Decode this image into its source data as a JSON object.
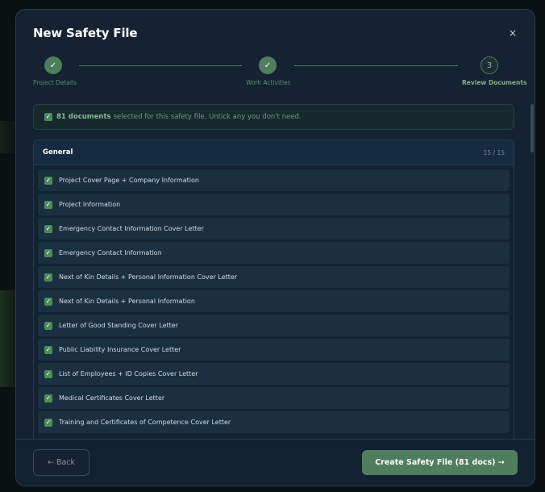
{
  "modal": {
    "title": "New Safety File",
    "close_label": "×"
  },
  "stepper": {
    "steps": [
      {
        "label": "Project Details",
        "state": "done",
        "marker": "✓"
      },
      {
        "label": "Work Activities",
        "state": "done",
        "marker": "✓"
      },
      {
        "label": "Review Documents",
        "state": "current",
        "marker": "3"
      }
    ]
  },
  "info": {
    "count_text": "81 documents",
    "message": "selected for this safety file. Untick any you don't need."
  },
  "group": {
    "title": "General",
    "count": "15 / 15",
    "items": [
      {
        "label": "Project Cover Page + Company Information",
        "checked": true
      },
      {
        "label": "Project Information",
        "checked": true
      },
      {
        "label": "Emergency Contact Information Cover Letter",
        "checked": true
      },
      {
        "label": "Emergency Contact Information",
        "checked": true
      },
      {
        "label": "Next of Kin Details + Personal Information Cover Letter",
        "checked": true
      },
      {
        "label": "Next of Kin Details + Personal Information",
        "checked": true
      },
      {
        "label": "Letter of Good Standing Cover Letter",
        "checked": true
      },
      {
        "label": "Public Liability Insurance Cover Letter",
        "checked": true
      },
      {
        "label": "List of Employees + ID Copies Cover Letter",
        "checked": true
      },
      {
        "label": "Medical Certificates Cover Letter",
        "checked": true
      },
      {
        "label": "Training and Certificates of Competence Cover Letter",
        "checked": true
      }
    ]
  },
  "footer": {
    "back_label": "← Back",
    "create_label": "Create Safety File (81 docs) →"
  },
  "colors": {
    "accent": "#4f7d5e",
    "modal_bg": "#142231",
    "checkbox": "#4f8a5c"
  }
}
